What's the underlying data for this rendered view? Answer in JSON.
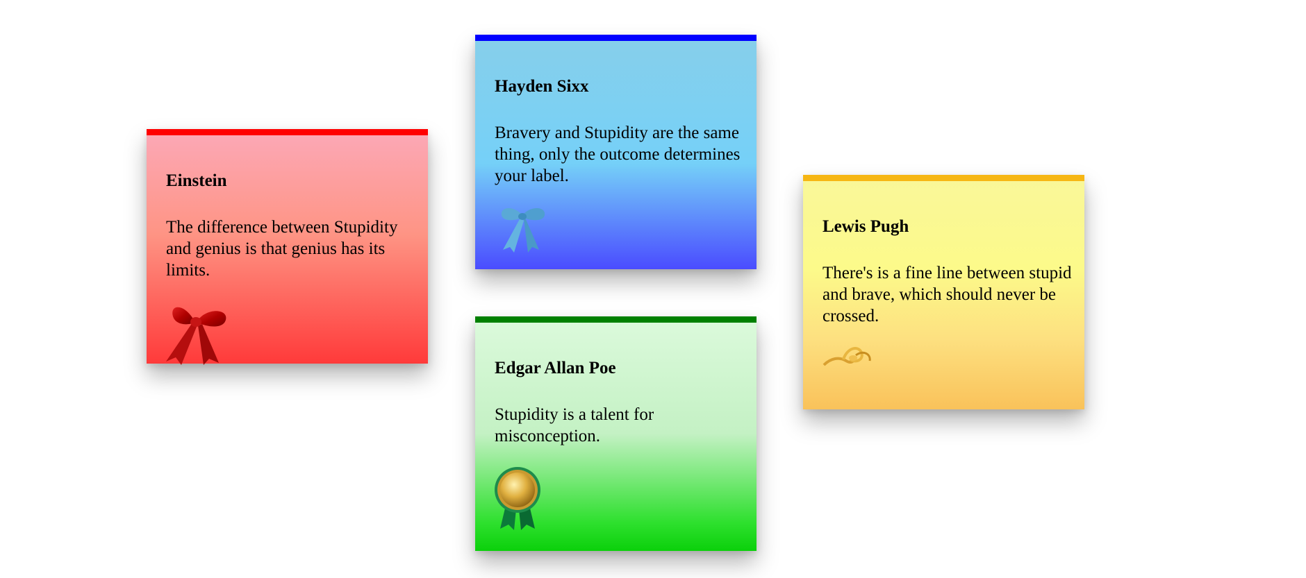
{
  "cards": [
    {
      "name": "Einstein",
      "quote": "The difference between Stupidity and genius is that genius has its limits.",
      "color": "#ff0000",
      "icon": "red-bow-icon"
    },
    {
      "name": "Hayden Sixx",
      "quote": "Bravery and Stupidity are the same thing, only the outcome determines your label.",
      "color": "#0000ff",
      "icon": "blue-bow-icon"
    },
    {
      "name": "Edgar Allan Poe",
      "quote": "Stupidity is a talent for misconception.",
      "color": "#008000",
      "icon": "gold-medal-ribbon-icon"
    },
    {
      "name": "Lewis Pugh",
      "quote": "There's is a fine line between stupid and brave, which should never be crossed.",
      "color": "#f6b614",
      "icon": "gold-ribbon-curl-icon"
    }
  ]
}
